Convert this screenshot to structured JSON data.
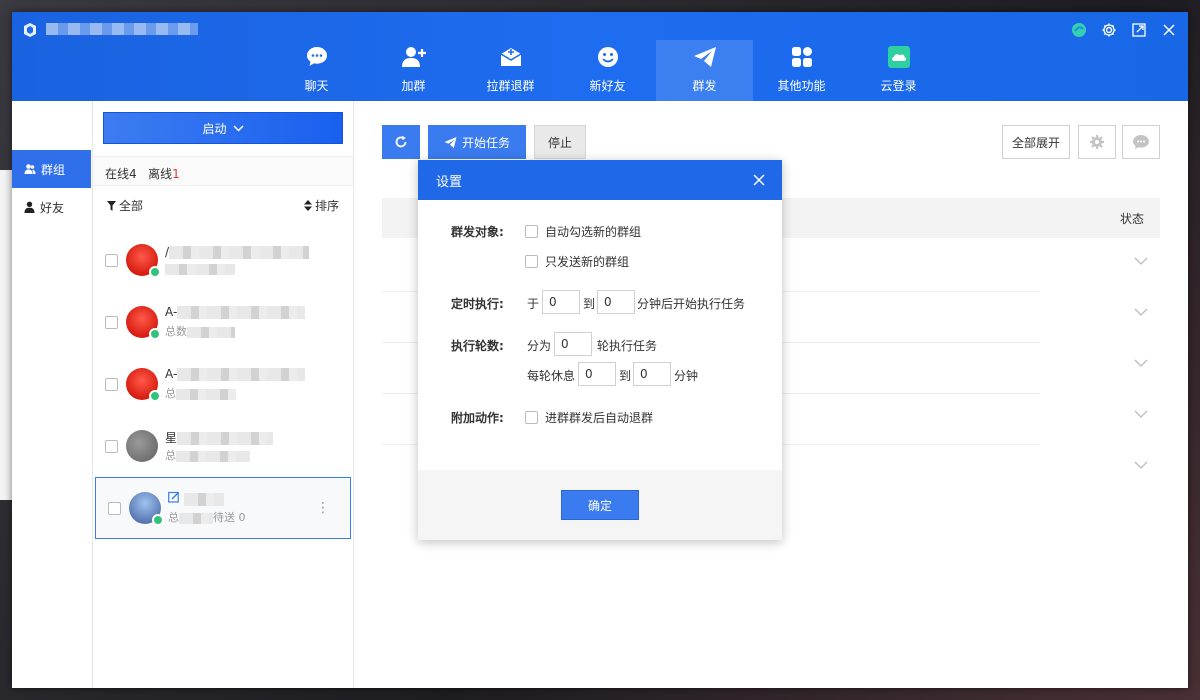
{
  "nav": {
    "items": [
      {
        "label": "聊天",
        "icon": "chat-bubble-icon"
      },
      {
        "label": "加群",
        "icon": "add-user-icon"
      },
      {
        "label": "拉群退群",
        "icon": "mail-icon"
      },
      {
        "label": "新好友",
        "icon": "smiley-icon"
      },
      {
        "label": "群发",
        "icon": "paper-plane-icon"
      },
      {
        "label": "其他功能",
        "icon": "grid-icon"
      },
      {
        "label": "云登录",
        "icon": "cloud-icon"
      }
    ],
    "active_index": 4
  },
  "side_tabs": {
    "groups": "群组",
    "friends": "好友"
  },
  "list_panel": {
    "start_label": "启动",
    "online_label": "在线",
    "online_count": "4",
    "offline_label": "离线",
    "offline_count": "1",
    "filter_label": "全部",
    "sort_label": "排序",
    "groups": [
      {
        "name_prefix": "/",
        "sub_prefix": ""
      },
      {
        "name_prefix": "A-",
        "sub_prefix": "总数"
      },
      {
        "name_prefix": "A-",
        "sub_prefix": "总"
      },
      {
        "name_prefix": "星",
        "sub_prefix": "总"
      },
      {
        "name_prefix": "",
        "sub_prefix": "总",
        "sub_suffix": "待送 0"
      }
    ]
  },
  "toolbar": {
    "start_task_label": "开始任务",
    "stop_label": "停止",
    "expand_all_label": "全部展开"
  },
  "table": {
    "status_header": "状态"
  },
  "modal": {
    "title": "设置",
    "target_label": "群发对象:",
    "auto_select_new": "自动勾选新的群组",
    "only_send_new": "只发送新的群组",
    "schedule_label": "定时执行:",
    "schedule_from_prefix": "于",
    "schedule_from_value": "0",
    "schedule_to": "到",
    "schedule_to_value": "0",
    "schedule_suffix": "分钟后开始执行任务",
    "rounds_label": "执行轮数:",
    "rounds_prefix": "分为",
    "rounds_value": "0",
    "rounds_suffix": "轮执行任务",
    "rest_prefix": "每轮休息",
    "rest_from_value": "0",
    "rest_to": "到",
    "rest_to_value": "0",
    "rest_suffix": "分钟",
    "extra_label": "附加动作:",
    "auto_quit": "进群群发后自动退群",
    "ok_label": "确定"
  },
  "colors": {
    "brand_blue": "#1e6cf0",
    "online_green": "#31c27c",
    "offline_red": "#e23b3b"
  }
}
